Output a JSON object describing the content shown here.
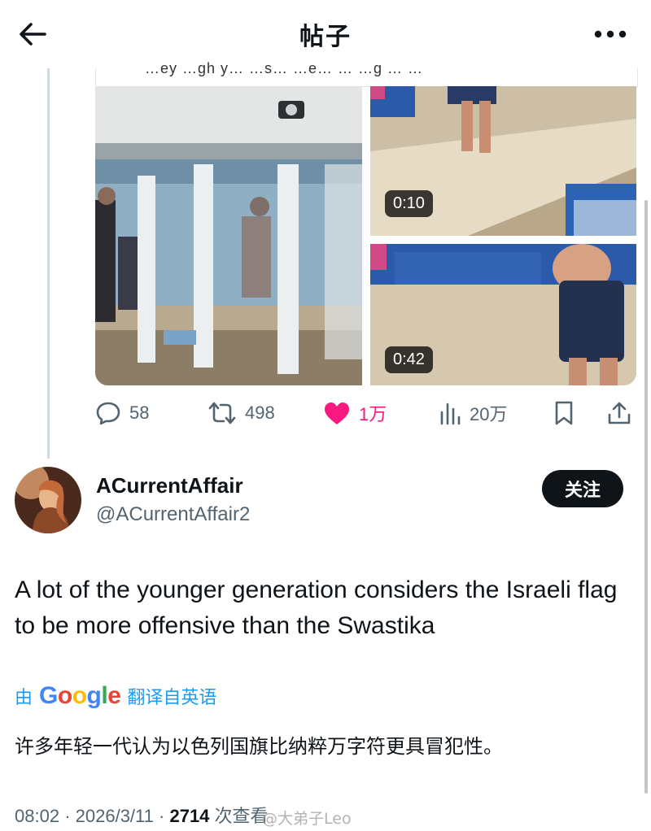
{
  "header": {
    "title": "帖子"
  },
  "media": {
    "cut_text": "…ey …gh y… …s… …e… … …g … …",
    "videos": [
      {
        "duration": "0:10"
      },
      {
        "duration": "0:42"
      }
    ]
  },
  "actions": {
    "replies": "58",
    "reposts": "498",
    "likes": "1万",
    "views": "20万"
  },
  "author": {
    "display_name": "ACurrentAffair",
    "handle": "@ACurrentAffair2",
    "follow_label": "关注"
  },
  "tweet": {
    "text": "A lot of the younger generation considers the Israeli flag to be more offensive than the Swastika"
  },
  "translation": {
    "prefix": "由",
    "google": [
      "G",
      "o",
      "o",
      "g",
      "l",
      "e"
    ],
    "suffix": "翻译自英语",
    "text": "许多年轻一代认为以色列国旗比纳粹万字符更具冒犯性。"
  },
  "meta": {
    "time": "08:02",
    "date": "2026/3/11",
    "views": "2714",
    "views_label": "次查看"
  },
  "watermark": "@大弟子Leo",
  "colors": {
    "accent": "#1d9bf0",
    "like": "#f91880",
    "text": "#0f1419",
    "muted": "#536471"
  }
}
